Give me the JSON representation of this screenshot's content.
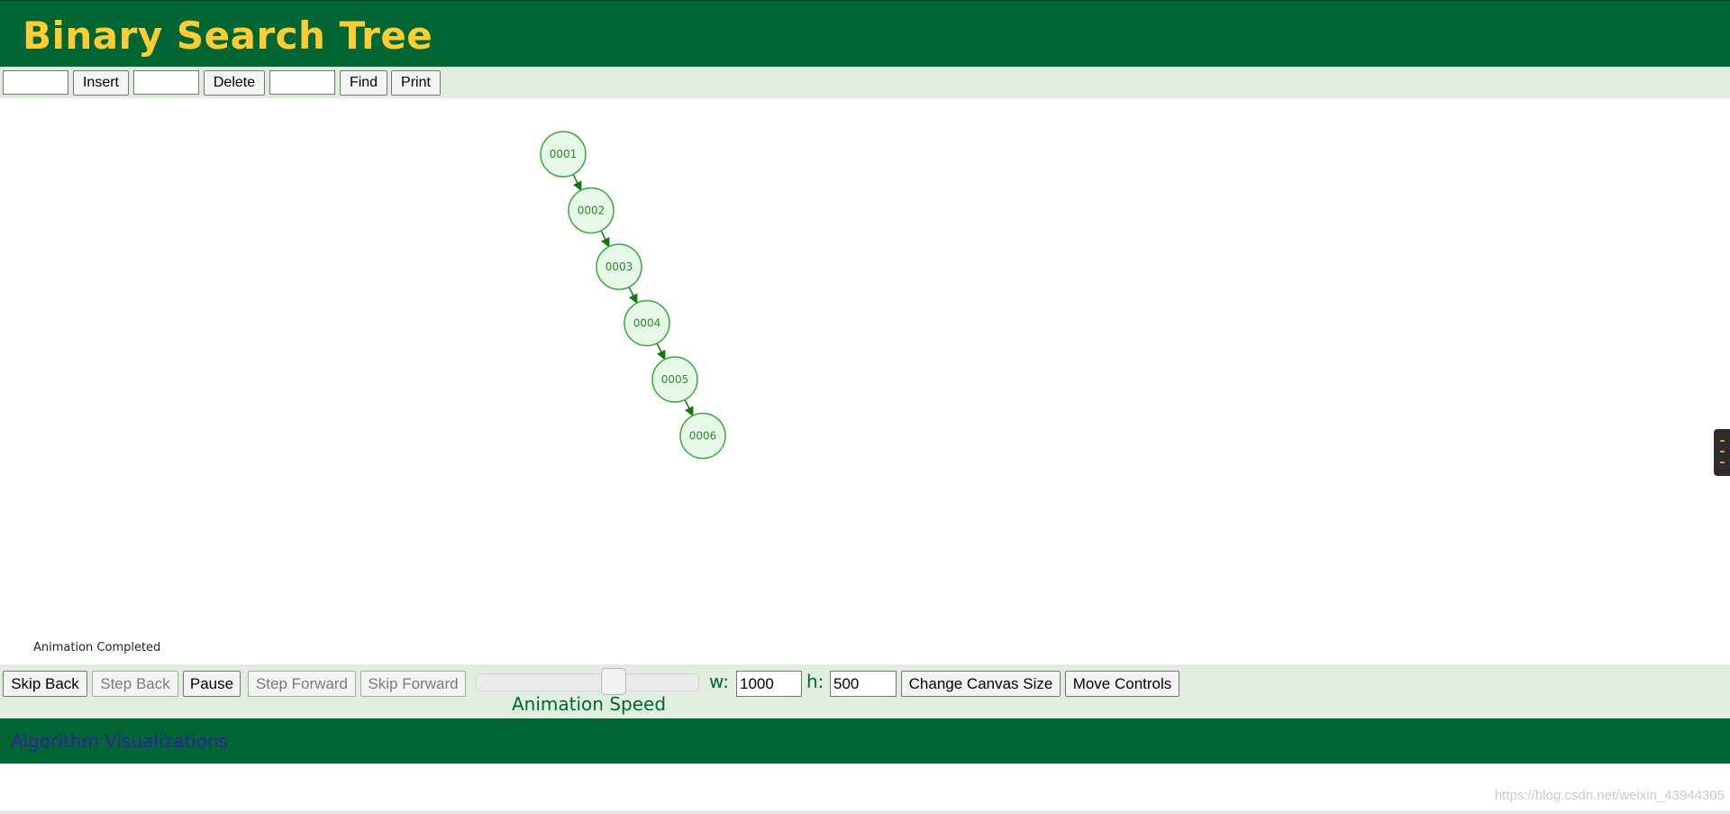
{
  "header": {
    "title": "Binary Search Tree"
  },
  "toolbar": {
    "insert_value": "",
    "insert_label": "Insert",
    "delete_value": "",
    "delete_label": "Delete",
    "find_value": "",
    "find_label": "Find",
    "print_label": "Print"
  },
  "tree": {
    "nodes": [
      "0001",
      "0002",
      "0003",
      "0004",
      "0005",
      "0006"
    ],
    "colors": {
      "node_fill": "#e8f8e8",
      "node_stroke": "#3aa83a",
      "node_text": "#2a8a2a",
      "edge": "#117711"
    }
  },
  "status": {
    "text": "Animation Completed"
  },
  "controls": {
    "skip_back": "Skip Back",
    "step_back": "Step Back",
    "pause": "Pause",
    "step_forward": "Step Forward",
    "skip_forward": "Skip Forward",
    "speed_label": "Animation Speed",
    "speed_level": 0.63,
    "w_label": "w:",
    "w_value": "1000",
    "h_label": "h:",
    "h_value": "500",
    "change_canvas_size": "Change Canvas Size",
    "move_controls": "Move Controls"
  },
  "footer": {
    "link_text": "Algorithm Visualizations"
  },
  "watermark": {
    "text": "https://blog.csdn.net/weixin_43944305"
  },
  "theme": {
    "header_bg": "#006633",
    "title_color": "#ffcc33",
    "toolbar_bg": "#dfeedd"
  }
}
